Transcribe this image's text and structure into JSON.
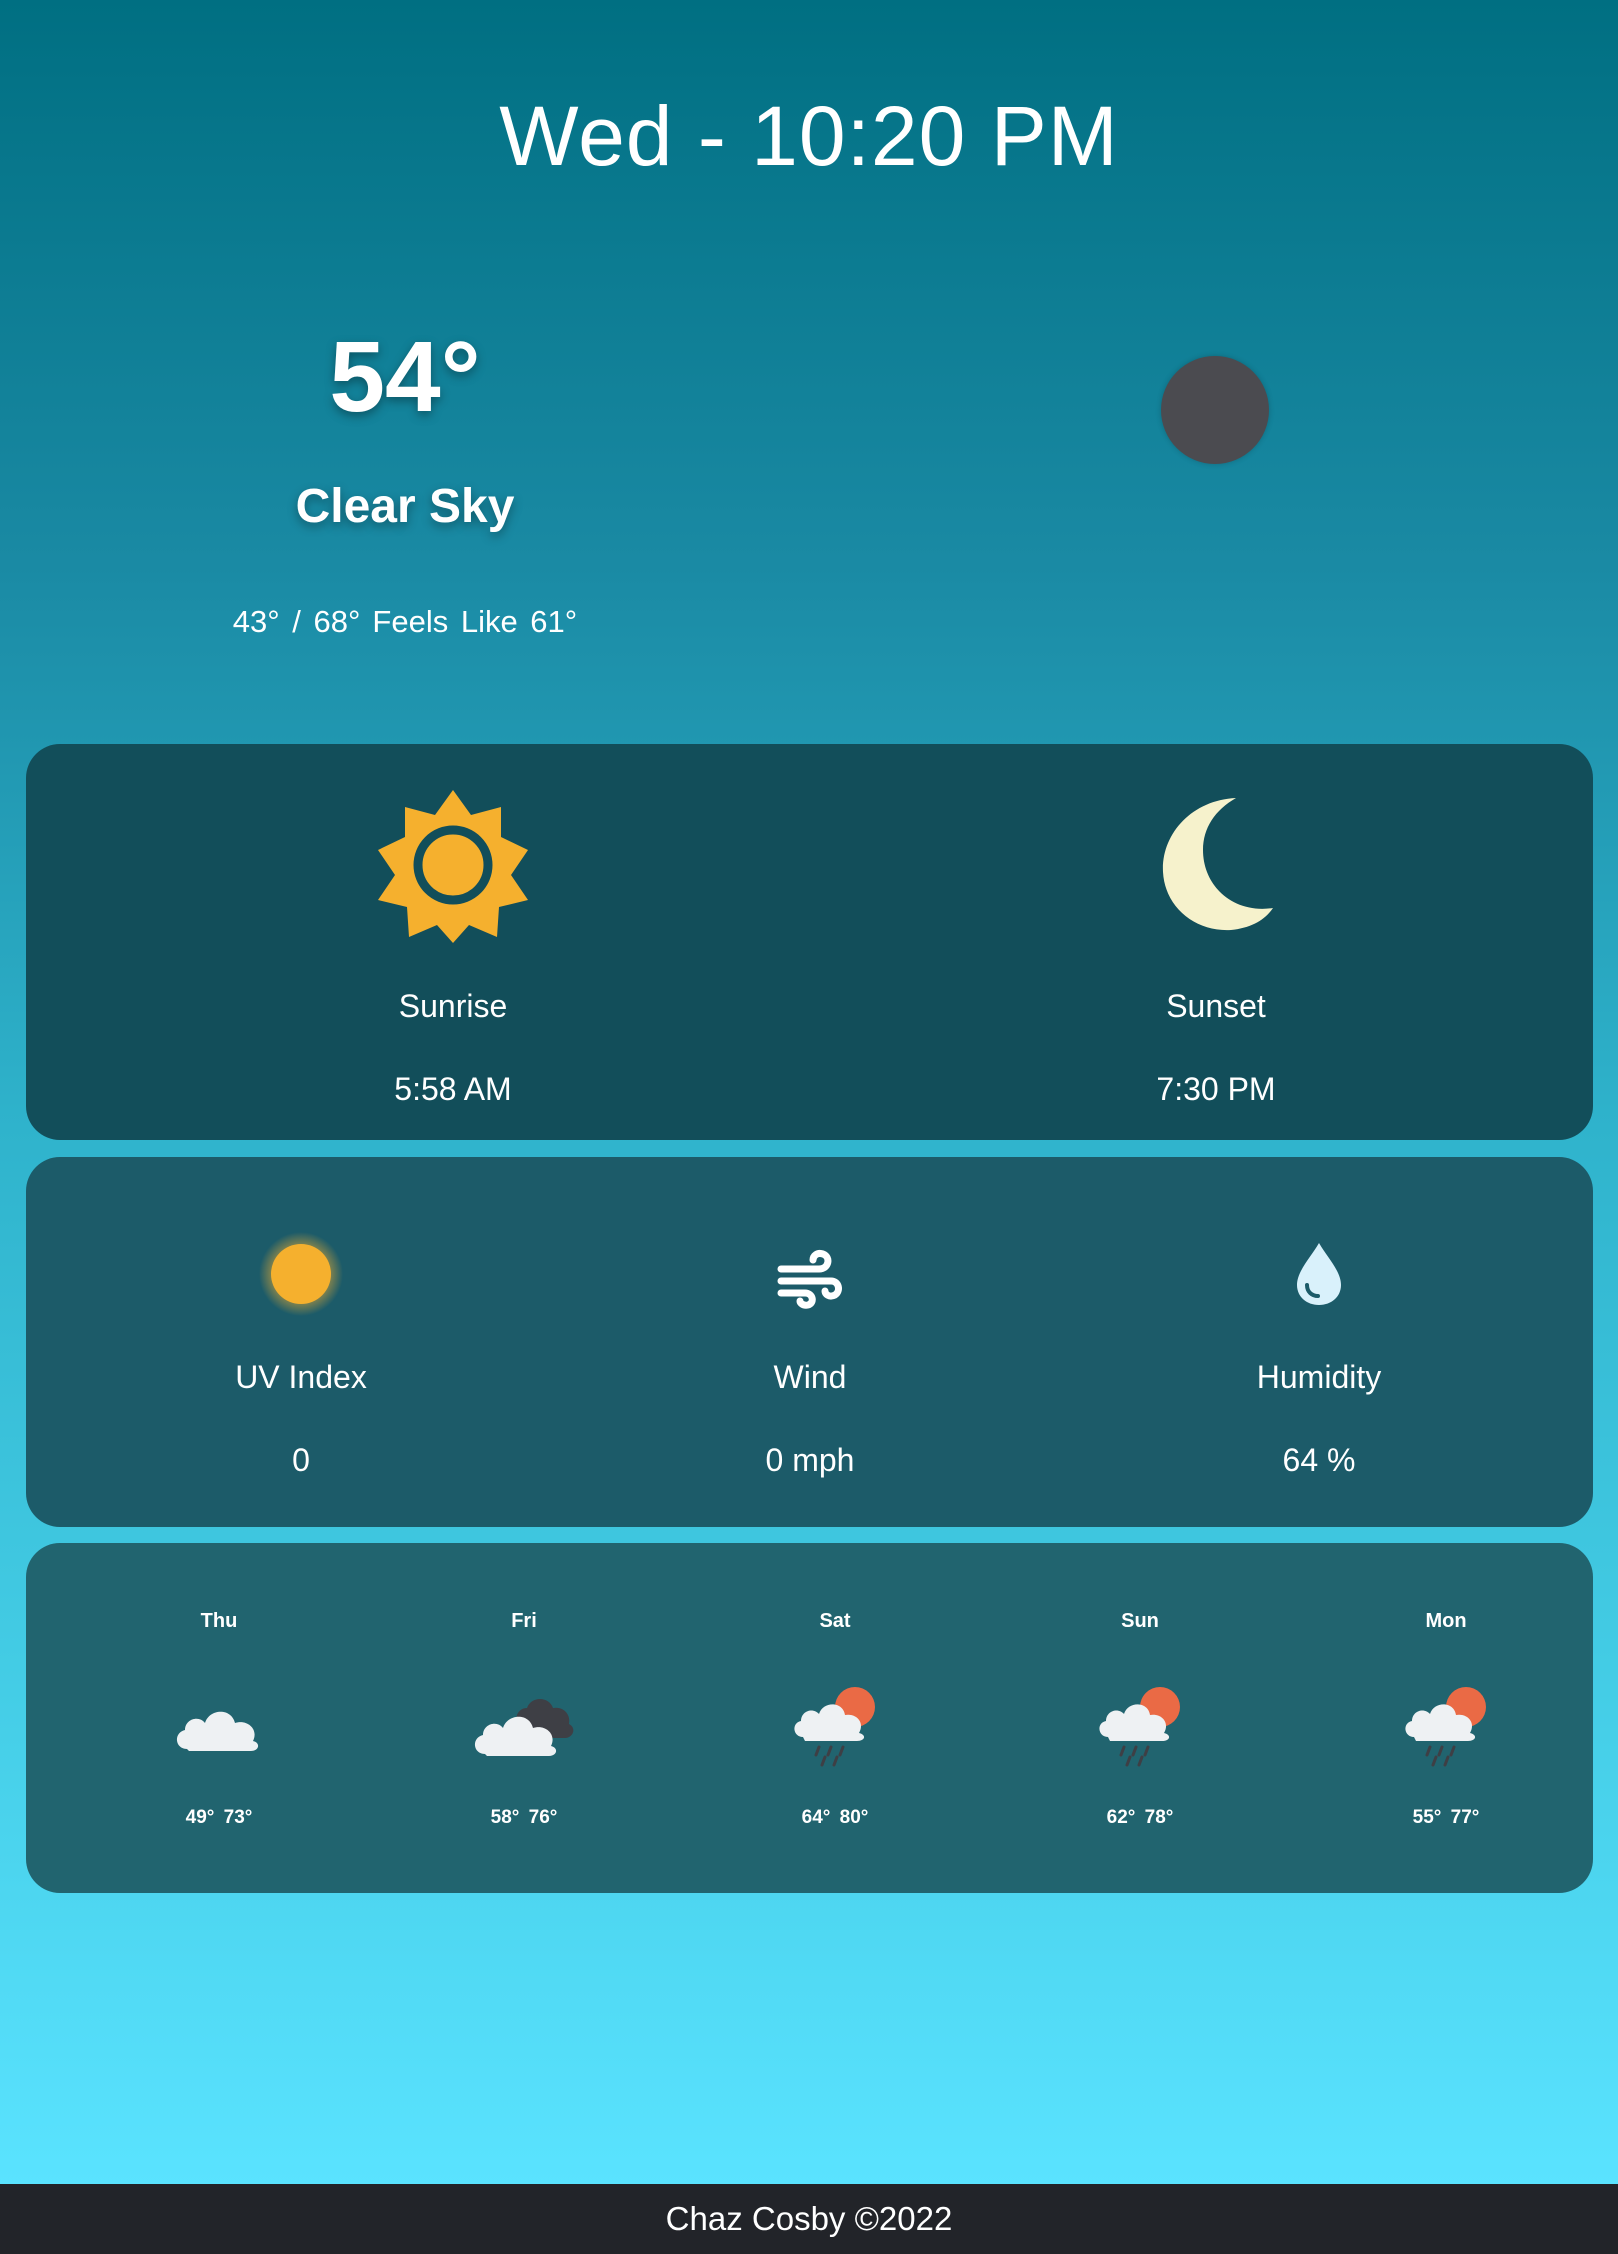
{
  "header": {
    "datetime": "Wed - 10:20 PM"
  },
  "current": {
    "temp": "54°",
    "condition": "Clear Sky",
    "low_high": "43° / 68°",
    "feels_like": "Feels Like 61°",
    "condition_icon": "moon-dot-icon"
  },
  "sun": {
    "sunrise": {
      "label": "Sunrise",
      "value": "5:58 AM",
      "icon": "sun-icon"
    },
    "sunset": {
      "label": "Sunset",
      "value": "7:30 PM",
      "icon": "crescent-moon-icon"
    }
  },
  "stats": [
    {
      "label": "UV Index",
      "value": "0",
      "icon": "uv-sun-icon"
    },
    {
      "label": "Wind",
      "value": "0 mph",
      "icon": "wind-icon"
    },
    {
      "label": "Humidity",
      "value": "64 %",
      "icon": "water-drop-icon"
    }
  ],
  "forecast": [
    {
      "day": "Thu",
      "temps": "49°  73°",
      "icon": "cloud-icon"
    },
    {
      "day": "Fri",
      "temps": "58°  76°",
      "icon": "clouds-icon"
    },
    {
      "day": "Sat",
      "temps": "64°  80°",
      "icon": "rain-sun-icon"
    },
    {
      "day": "Sun",
      "temps": "62°  78°",
      "icon": "rain-sun-icon"
    },
    {
      "day": "Mon",
      "temps": "55°  77°",
      "icon": "rain-sun-icon"
    }
  ],
  "footer": {
    "text": "Chaz Cosby ©2022"
  },
  "colors": {
    "sun_orange": "#f5b02e",
    "moon_cream": "#f6f2cc",
    "card_dark": "#124e5a",
    "footer_bg": "#222429"
  }
}
